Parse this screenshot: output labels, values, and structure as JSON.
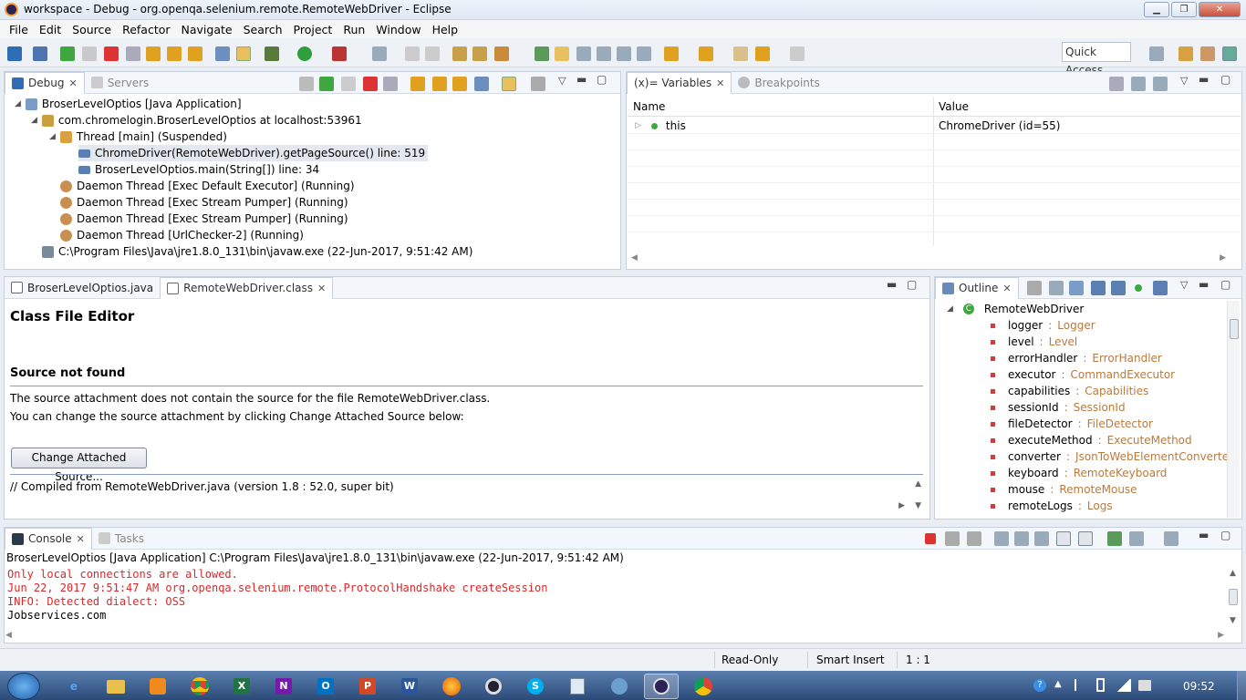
{
  "window": {
    "title": "workspace - Debug - org.openqa.selenium.remote.RemoteWebDriver - Eclipse"
  },
  "menu": [
    "File",
    "Edit",
    "Source",
    "Refactor",
    "Navigate",
    "Search",
    "Project",
    "Run",
    "Window",
    "Help"
  ],
  "quick_access": "Quick Access",
  "debug_view": {
    "tabs": [
      "Debug",
      "Servers"
    ],
    "tree": [
      "BroserLevelOptios [Java Application]",
      "com.chromelogin.BroserLevelOptios at localhost:53961",
      "Thread [main] (Suspended)",
      "ChromeDriver(RemoteWebDriver).getPageSource() line: 519",
      "BroserLevelOptios.main(String[]) line: 34",
      "Daemon Thread [Exec Default Executor] (Running)",
      "Daemon Thread [Exec Stream Pumper] (Running)",
      "Daemon Thread [Exec Stream Pumper] (Running)",
      "Daemon Thread [UrlChecker-2] (Running)",
      "C:\\Program Files\\Java\\jre1.8.0_131\\bin\\javaw.exe (22-Jun-2017, 9:51:42 AM)"
    ]
  },
  "variables_view": {
    "tabs": [
      "(x)= Variables",
      "Breakpoints"
    ],
    "columns": [
      "Name",
      "Value"
    ],
    "rows": [
      {
        "name": "this",
        "value": "ChromeDriver  (id=55)"
      }
    ]
  },
  "editor": {
    "tabs": [
      "BroserLevelOptios.java",
      "RemoteWebDriver.class"
    ],
    "heading": "Class File Editor",
    "subheading": "Source not found",
    "line1": "The source attachment does not contain the source for the file RemoteWebDriver.class.",
    "line2": "You can change the source attachment by clicking Change Attached Source below:",
    "button": "Change Attached Source...",
    "compiled": "// Compiled from RemoteWebDriver.java (version 1.8 : 52.0, super bit)"
  },
  "outline": {
    "tab": "Outline",
    "root": "RemoteWebDriver",
    "fields": [
      {
        "name": "logger",
        "type": "Logger"
      },
      {
        "name": "level",
        "type": "Level"
      },
      {
        "name": "errorHandler",
        "type": "ErrorHandler"
      },
      {
        "name": "executor",
        "type": "CommandExecutor"
      },
      {
        "name": "capabilities",
        "type": "Capabilities"
      },
      {
        "name": "sessionId",
        "type": "SessionId"
      },
      {
        "name": "fileDetector",
        "type": "FileDetector"
      },
      {
        "name": "executeMethod",
        "type": "ExecuteMethod"
      },
      {
        "name": "converter",
        "type": "JsonToWebElementConverter"
      },
      {
        "name": "keyboard",
        "type": "RemoteKeyboard"
      },
      {
        "name": "mouse",
        "type": "RemoteMouse"
      },
      {
        "name": "remoteLogs",
        "type": "Logs"
      }
    ]
  },
  "console": {
    "tabs": [
      "Console",
      "Tasks"
    ],
    "header": "BroserLevelOptios [Java Application] C:\\Program Files\\Java\\jre1.8.0_131\\bin\\javaw.exe (22-Jun-2017, 9:51:42 AM)",
    "lines": [
      {
        "text": "Only local connections are allowed.",
        "color": "red"
      },
      {
        "text": "Jun 22, 2017 9:51:47 AM org.openqa.selenium.remote.ProtocolHandshake createSession",
        "color": "red"
      },
      {
        "text": "INFO: Detected dialect: OSS",
        "color": "red"
      },
      {
        "text": "Jobservices.com",
        "color": "black"
      }
    ]
  },
  "status": {
    "mode": "Read-Only",
    "insert": "Smart Insert",
    "position": "1 : 1"
  },
  "taskbar": {
    "clock": "09:52"
  }
}
